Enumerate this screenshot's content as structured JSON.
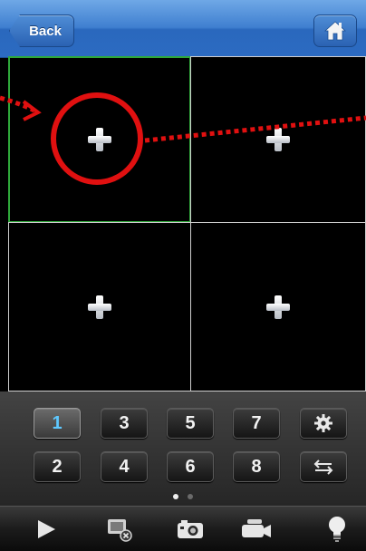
{
  "navbar": {
    "back_label": "Back",
    "home_icon": "home-icon",
    "accent_color": "#2c6bc2"
  },
  "grid": {
    "cells": [
      {
        "icon": "plus-icon",
        "selected": true
      },
      {
        "icon": "plus-icon",
        "selected": false
      },
      {
        "icon": "plus-icon",
        "selected": false
      },
      {
        "icon": "plus-icon",
        "selected": false
      }
    ],
    "selected_border_color": "#2fa83a"
  },
  "keypad": {
    "row1": [
      "1",
      "3",
      "5",
      "7"
    ],
    "row2": [
      "2",
      "4",
      "6",
      "8"
    ],
    "active_key": "1",
    "active_color": "#5ec8ff",
    "settings_icon": "gear-icon",
    "swap_icon": "swap-arrows-icon",
    "page_indicator": {
      "pages": 2,
      "current": 1
    }
  },
  "toolbar": {
    "icons": [
      "play-icon",
      "stop-video-icon",
      "camera-icon",
      "video-camera-icon",
      "light-bulb-icon"
    ]
  },
  "annotation": {
    "color": "#e01010"
  }
}
